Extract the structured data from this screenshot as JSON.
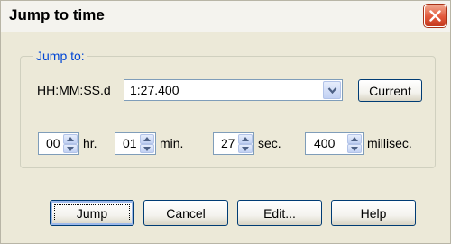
{
  "window": {
    "title": "Jump to time"
  },
  "group": {
    "legend": "Jump to:",
    "format_label": "HH:MM:SS.d",
    "time_value": "1:27.400",
    "current_label": "Current"
  },
  "fields": [
    {
      "value": "00",
      "unit": "hr."
    },
    {
      "value": "01",
      "unit": "min."
    },
    {
      "value": "27",
      "unit": "sec."
    },
    {
      "value": "400",
      "unit": "millisec."
    }
  ],
  "buttons": {
    "jump": "Jump",
    "cancel": "Cancel",
    "edit": "Edit...",
    "help": "Help"
  },
  "icons": {
    "close": "close-icon",
    "dropdown": "chevron-down-icon",
    "spin_up": "arrow-up-icon",
    "spin_down": "arrow-down-icon"
  },
  "colors": {
    "legend": "#0046d5",
    "close_button": "#e2583b",
    "dialog_background": "#ece9d8"
  }
}
